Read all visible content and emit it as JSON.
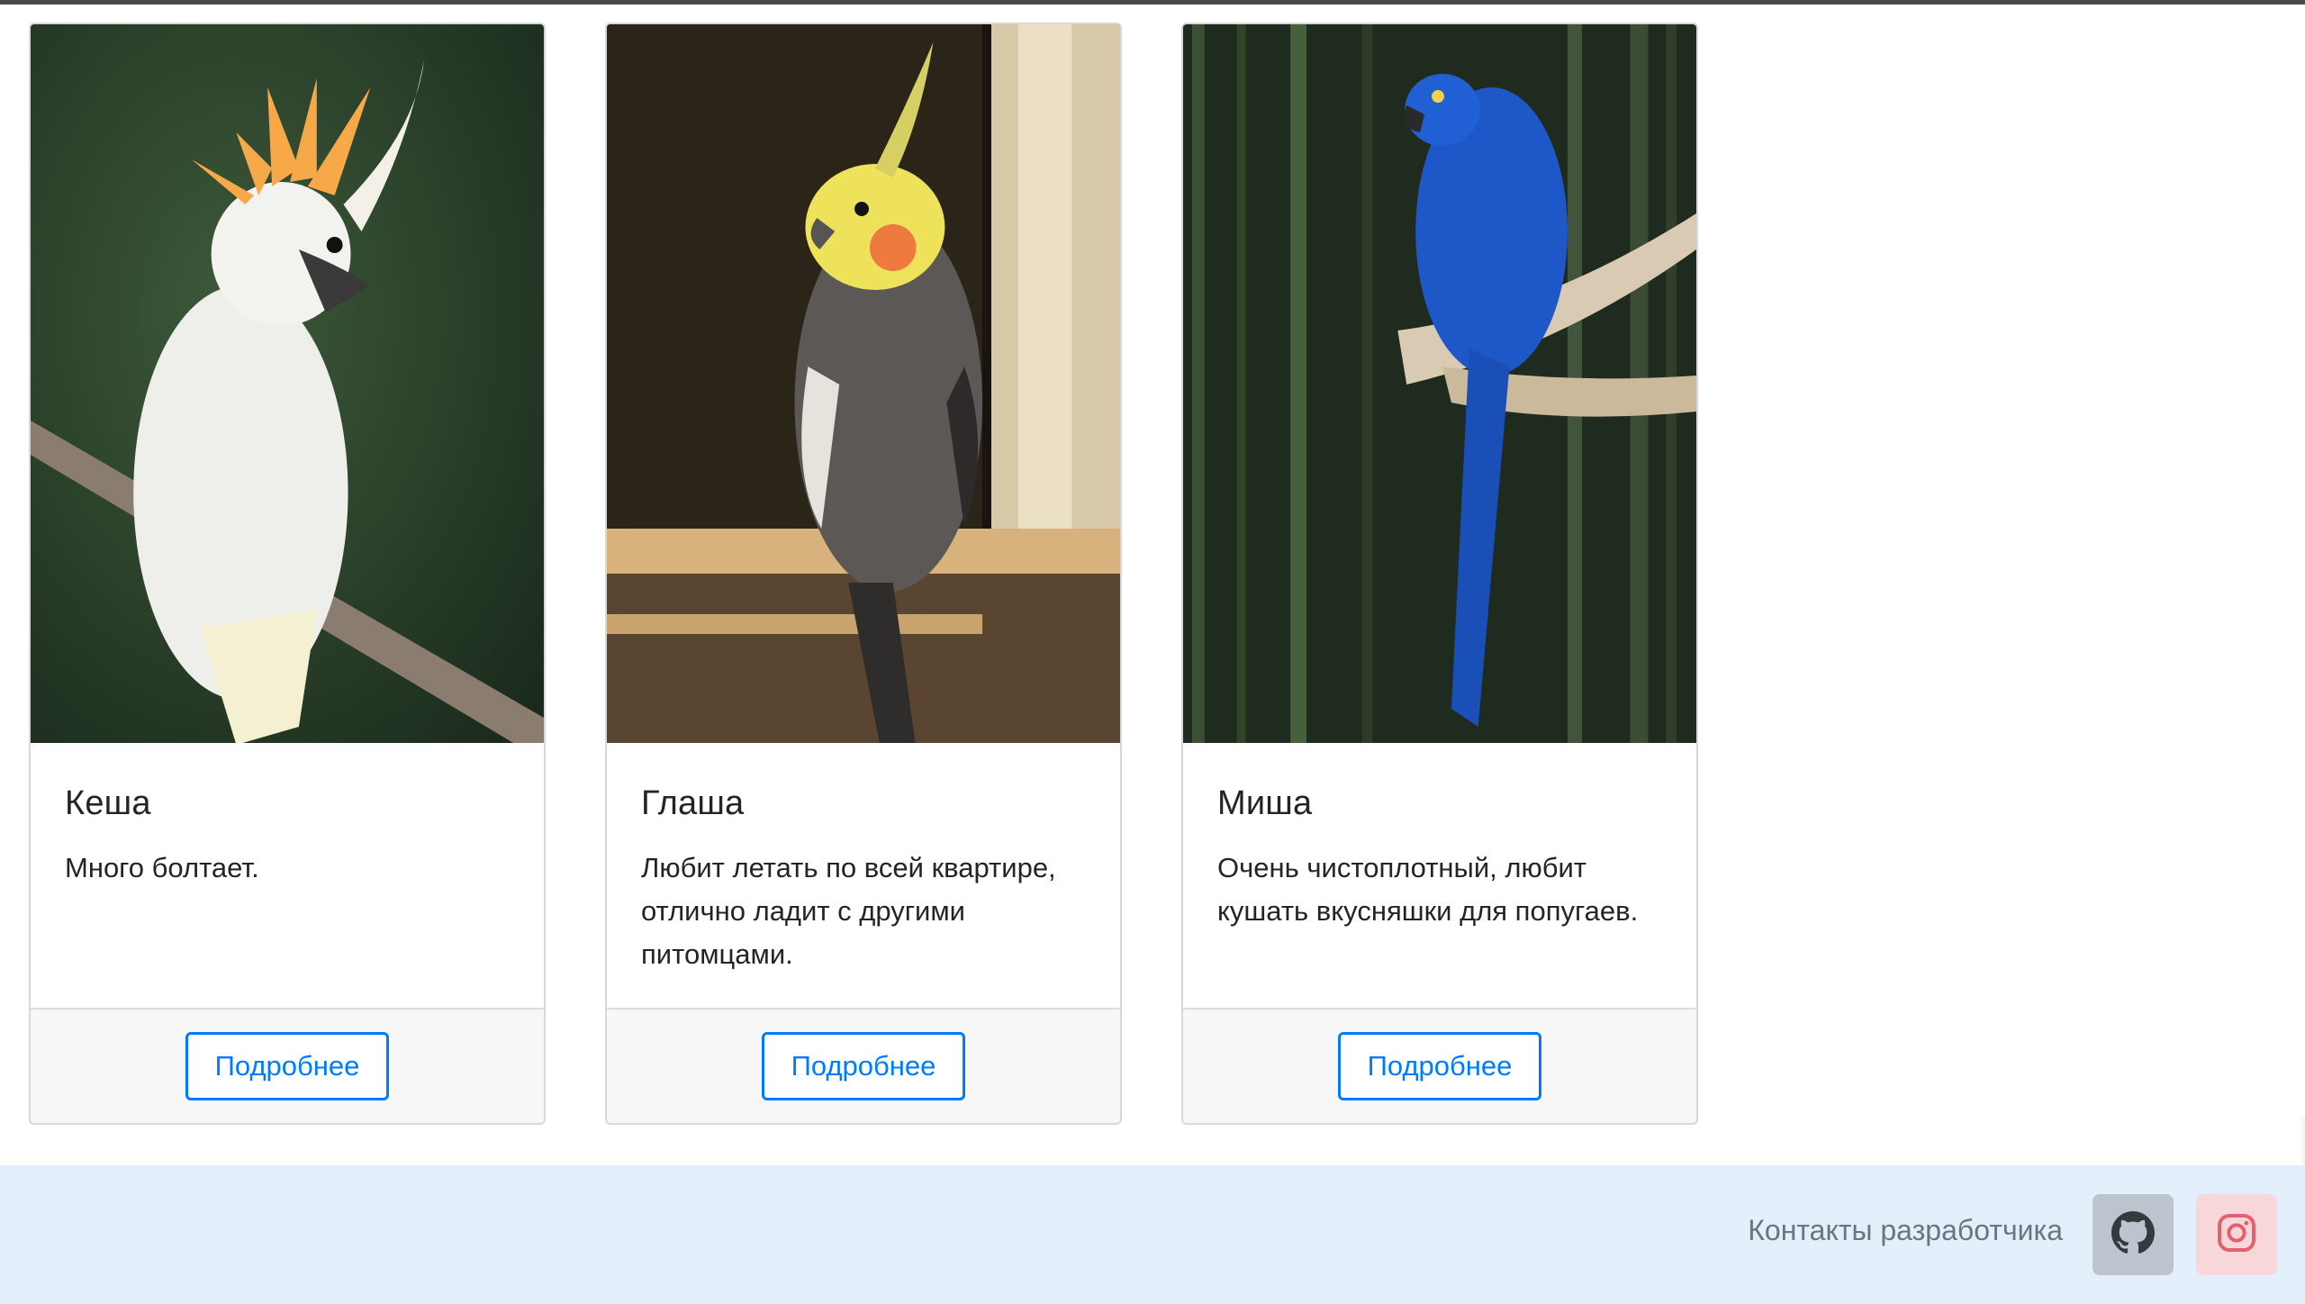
{
  "cards": [
    {
      "name": "Кеша",
      "description": "Много болтает.",
      "button_label": "Подробнее",
      "image_subject": "white cockatoo with orange crest"
    },
    {
      "name": "Глаша",
      "description": "Любит летать по всей квартире, отлично ладит с другими питомцами.",
      "button_label": "Подробнее",
      "image_subject": "grey cockatiel on wooden perch"
    },
    {
      "name": "Миша",
      "description": "Очень чистоплотный, любит кушать вкусняшки для попугаев.",
      "button_label": "Подробнее",
      "image_subject": "blue hyacinth macaw in bamboo"
    }
  ],
  "footer": {
    "contacts_label": "Контакты разработчика",
    "icons": [
      "github-icon",
      "instagram-icon"
    ]
  },
  "colors": {
    "primary": "#007bff",
    "footer_bg": "#e3f0fc",
    "github_bg": "#bcc5cd",
    "instagram_bg": "#f8d7da",
    "instagram_icon": "#e4606d"
  }
}
